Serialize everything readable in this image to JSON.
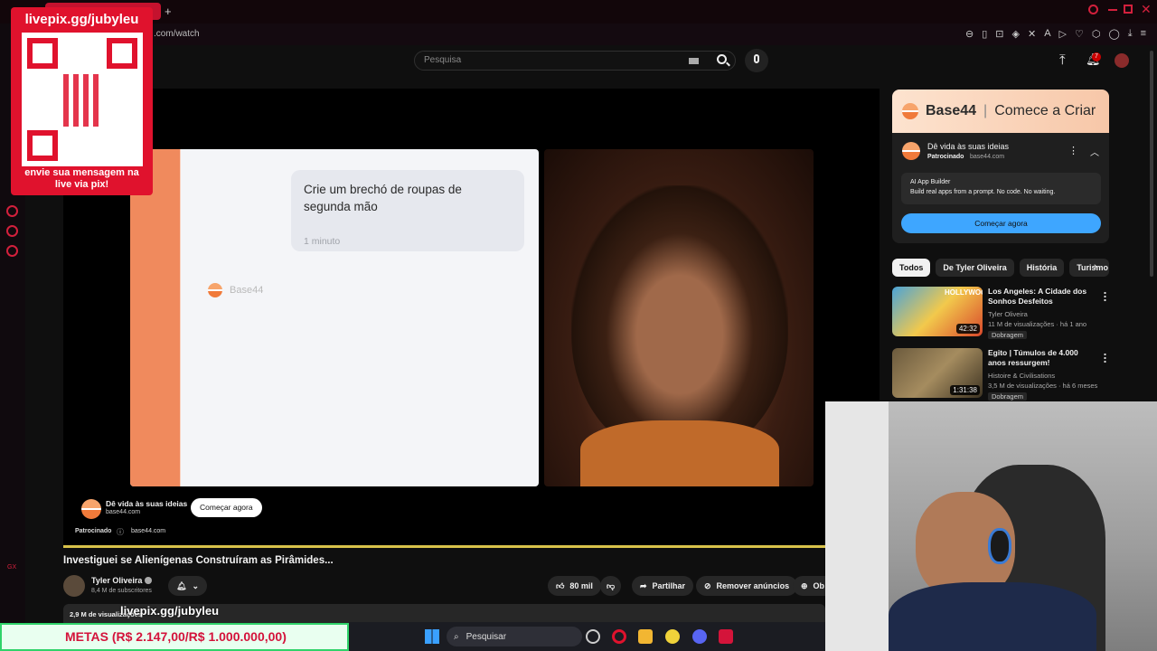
{
  "browser": {
    "url_fragment": ".com/watch",
    "notification_count": "7"
  },
  "qr_overlay": {
    "header": "livepix.gg/jubyleu",
    "footer": "envie sua mensagem na live via pix!"
  },
  "search": {
    "placeholder": "Pesquisa"
  },
  "player": {
    "chat_prompt": "Crie um brechó de roupas de segunda mão",
    "chat_time": "1 minuto",
    "brand_watermark": "Base44",
    "ad_title": "Dê vida às suas ideias",
    "ad_domain": "base44.com",
    "ad_cta": "Começar agora",
    "sponsored_label": "Patrocinado",
    "sponsored_domain": "base44.com"
  },
  "video": {
    "title": "Investiguei se Alienígenas Construíram as Pirâmides...",
    "channel": "Tyler Oliveira",
    "subscribers": "8,4 M de subscritores",
    "views_partial": "2,9 M de visualizações",
    "likes": "80 mil",
    "share_label": "Partilhar",
    "remove_ads_label": "Remover anúncios",
    "more_label": "Ob"
  },
  "ad_sidebar": {
    "banner_brand": "Base44",
    "banner_cta": "Comece a Criar",
    "title": "Dê vida às suas ideias",
    "sponsored": "Patrocinado",
    "domain": "base44.com",
    "feature_title": "AI App Builder",
    "feature_desc": "Build real apps from a prompt. No code. No waiting.",
    "button": "Começar agora"
  },
  "chips": [
    "Todos",
    "De Tyler Oliveira",
    "História",
    "Turismo"
  ],
  "recommendations": [
    {
      "title": "Los Angeles: A Cidade dos Sonhos Desfeitos",
      "channel": "Tyler Oliveira",
      "stats": "11 M de visualizações · há 1 ano",
      "badge": "Dobragem",
      "duration": "42:32",
      "thumb_text": "HOLLYWOOD"
    },
    {
      "title": "Egito | Túmulos de 4.000 anos ressurgem!",
      "channel": "Histoire & Civilisations",
      "stats": "3,5 M de visualizações · há 6 meses",
      "badge": "Dobragem",
      "duration": "1:31:38",
      "thumb_text": ""
    }
  ],
  "stream_overlay": {
    "livepix_text": "livepix.gg/jubyleu",
    "metas": "METAS (R$ 2.147,00/R$ 1.000.000,00)"
  },
  "taskbar": {
    "search_label": "Pesquisar"
  },
  "colors": {
    "accent_red": "#e0122d",
    "metas_green": "#30d36a",
    "yt_blue": "#3ea6ff"
  }
}
